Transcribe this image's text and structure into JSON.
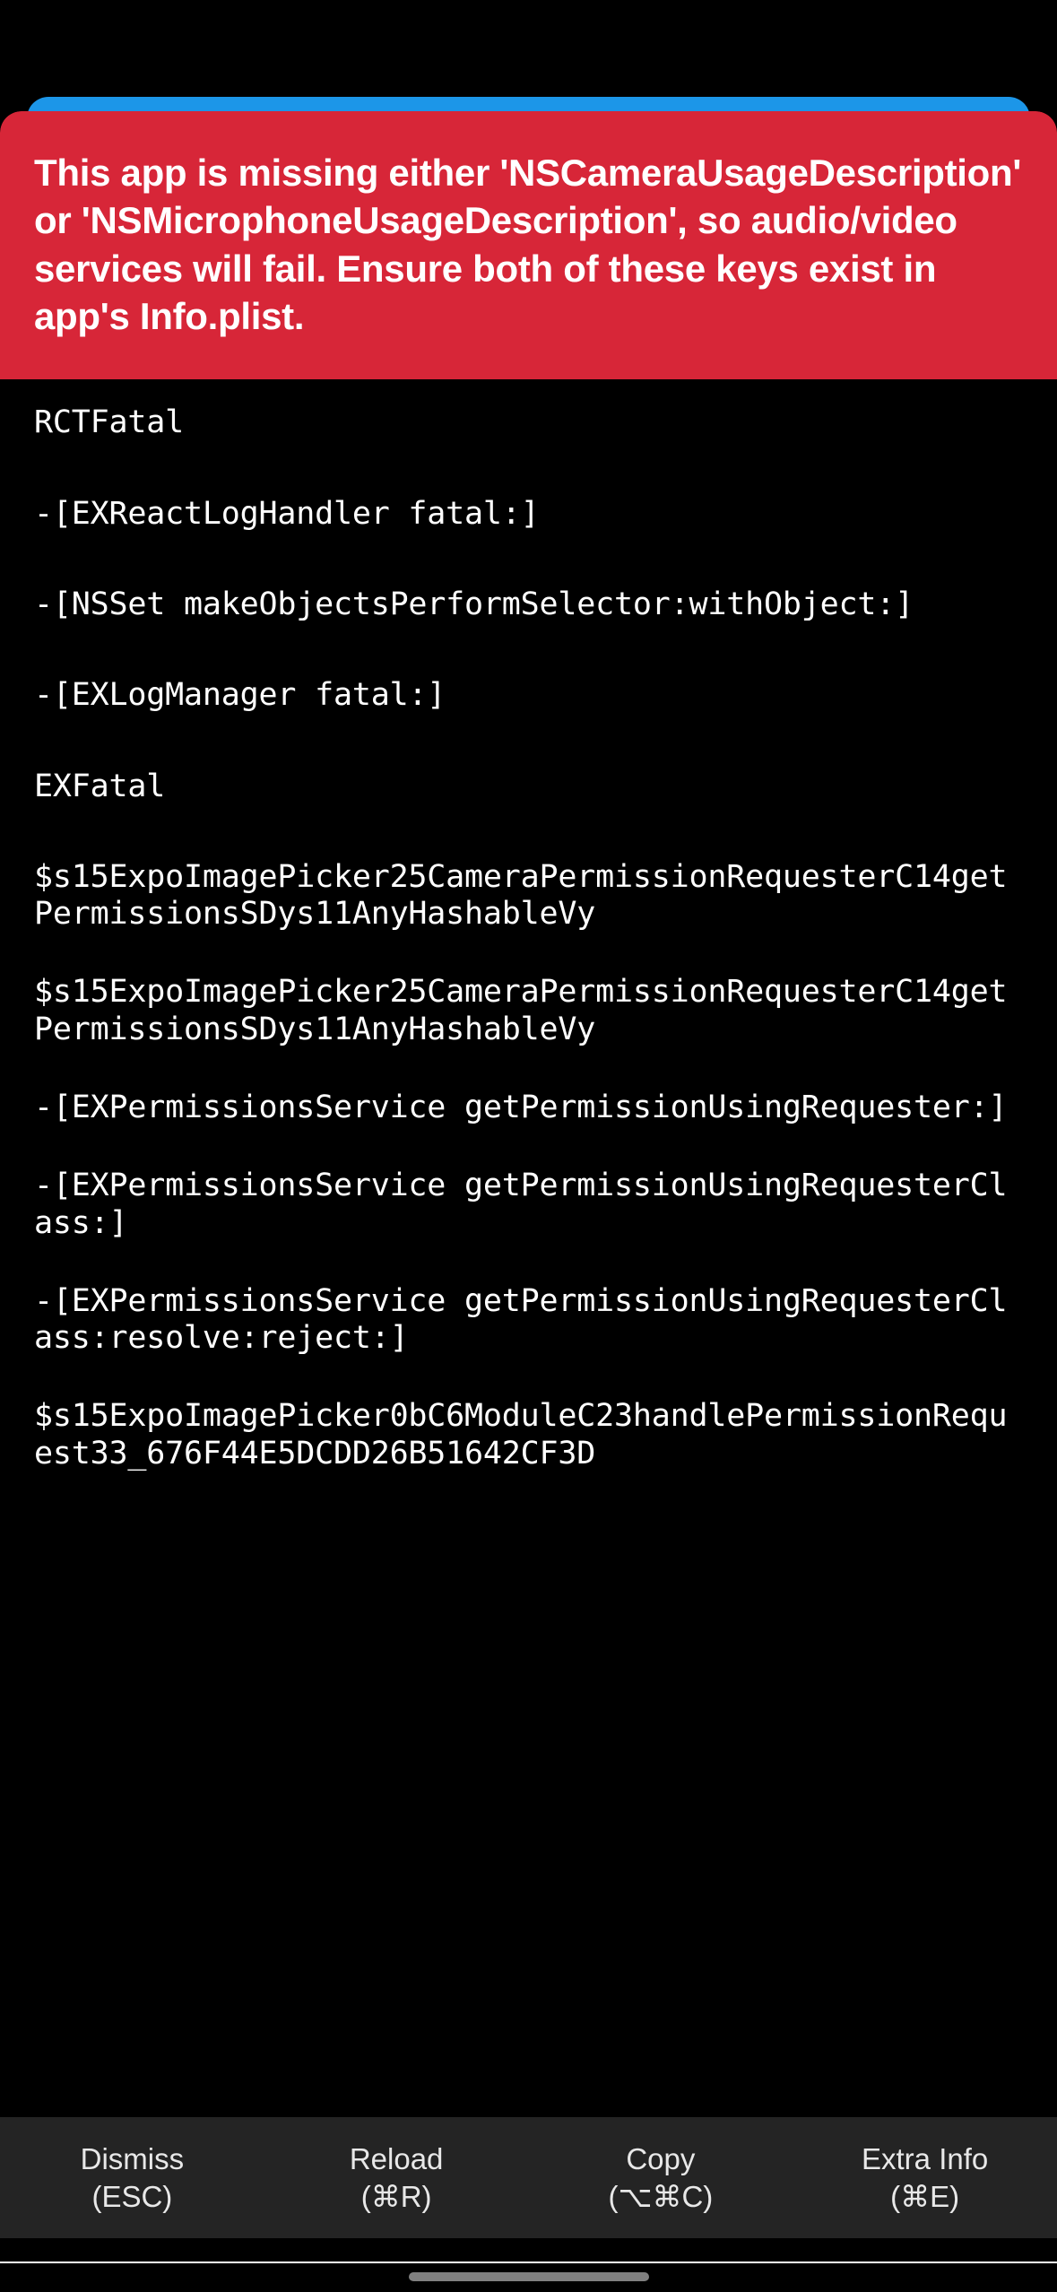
{
  "error": {
    "title": "This app is missing either 'NSCameraUsageDescription' or 'NSMicrophoneUsageDescription', so audio/video services will fail. Ensure both of these keys exist in app's Info.plist."
  },
  "stack": [
    "RCTFatal",
    "-[EXReactLogHandler fatal:]",
    "-[NSSet makeObjectsPerformSelector:withObject:]",
    "-[EXLogManager fatal:]",
    "EXFatal",
    "$s15ExpoImagePicker25CameraPermissionRequesterC14getPermissionsSDys11AnyHashableVy",
    "$s15ExpoImagePicker25CameraPermissionRequesterC14getPermissionsSDys11AnyHashableVy",
    "-[EXPermissionsService getPermissionUsingRequester:]",
    "-[EXPermissionsService getPermissionUsingRequesterClass:]",
    "-[EXPermissionsService getPermissionUsingRequesterClass:resolve:reject:]",
    "$s15ExpoImagePicker0bC6ModuleC23handlePermissionRequest33_676F44E5DCDD26B51642CF3D"
  ],
  "footer": {
    "dismiss": {
      "label": "Dismiss",
      "shortcut": "(ESC)"
    },
    "reload": {
      "label": "Reload",
      "shortcut": "(⌘R)"
    },
    "copy": {
      "label": "Copy",
      "shortcut": "(⌥⌘C)"
    },
    "extra": {
      "label": "Extra Info",
      "shortcut": "(⌘E)"
    }
  }
}
